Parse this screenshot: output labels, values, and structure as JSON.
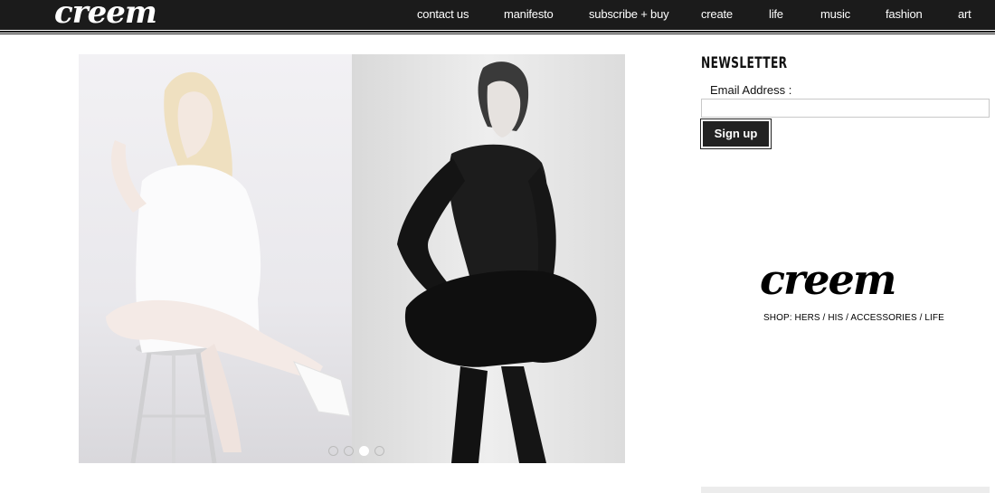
{
  "header": {
    "logo": "creem",
    "nav": [
      {
        "label": "contact us"
      },
      {
        "label": "manifesto"
      },
      {
        "label": "subscribe + buy"
      },
      {
        "label": "create"
      },
      {
        "label": "life"
      },
      {
        "label": "music"
      },
      {
        "label": "fashion"
      },
      {
        "label": "art"
      }
    ]
  },
  "slideshow": {
    "slide_count": 4,
    "active_slide": 3
  },
  "newsletter": {
    "title": "NEWSLETTER",
    "email_label": "Email Address :",
    "email_value": "",
    "signup_label": "Sign up"
  },
  "ad": {
    "logo": "creem",
    "shop_text": "SHOP: HERS / HIS / ACCESSORIES / LIFE"
  },
  "colors": {
    "nav_bg": "#1b1b1b",
    "button_bg": "#222222"
  }
}
